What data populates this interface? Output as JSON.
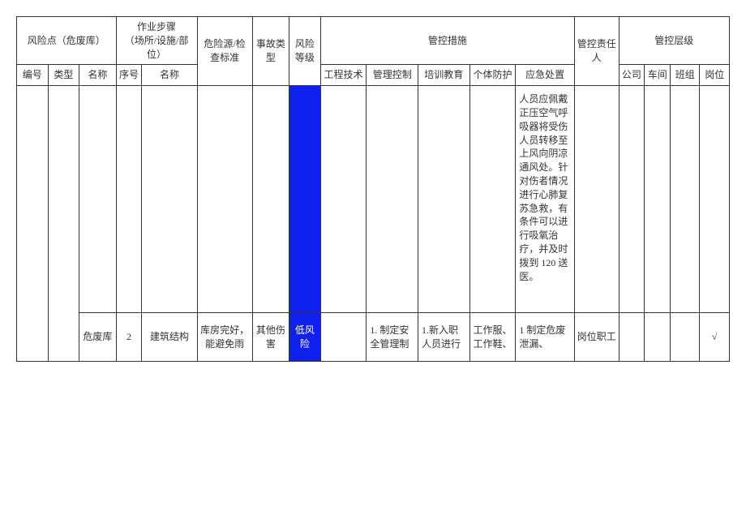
{
  "headers": {
    "risk_point": "风险点（危废库）",
    "work_step": "作业步骤\n（场所/设施/部位）",
    "hazard_std": "危险源/检查标准",
    "accident_type": "事故类型",
    "risk_level": "风险等级",
    "control_measures": "管控措施",
    "control_person": "管控责任人",
    "control_level": "管控层级",
    "sub": {
      "bh": "编号",
      "lx": "类型",
      "mc": "名称",
      "xh": "序号",
      "mc2": "名称",
      "gc": "工程技术",
      "gl": "管理控制",
      "px": "培训教育",
      "gt": "个体防护",
      "yj": "应急处置",
      "gs": "公司",
      "cj": "车间",
      "bz": "班组",
      "gw": "岗位"
    }
  },
  "row1": {
    "yj": "人员应佩戴正压空气呼吸器将受伤人员转移至上风向阴凉通风处。针对伤者情况进行心肺复苏急救，有条件可以进行吸氧治疗，并及时拨到 120 送医。"
  },
  "row2": {
    "mc": "危废库",
    "xh": "2",
    "mc2": "建筑结构",
    "std": "库房完好，能避免雨",
    "sglx": "其他伤害",
    "dj": "低风险",
    "gc": "",
    "gl": "1. 制定安全管理制",
    "px": "1.新入职人员进行",
    "gt": "工作服、工作鞋、",
    "yj": "1 制定危废泄漏、",
    "zr": "岗位职工",
    "gw_check": "√"
  }
}
